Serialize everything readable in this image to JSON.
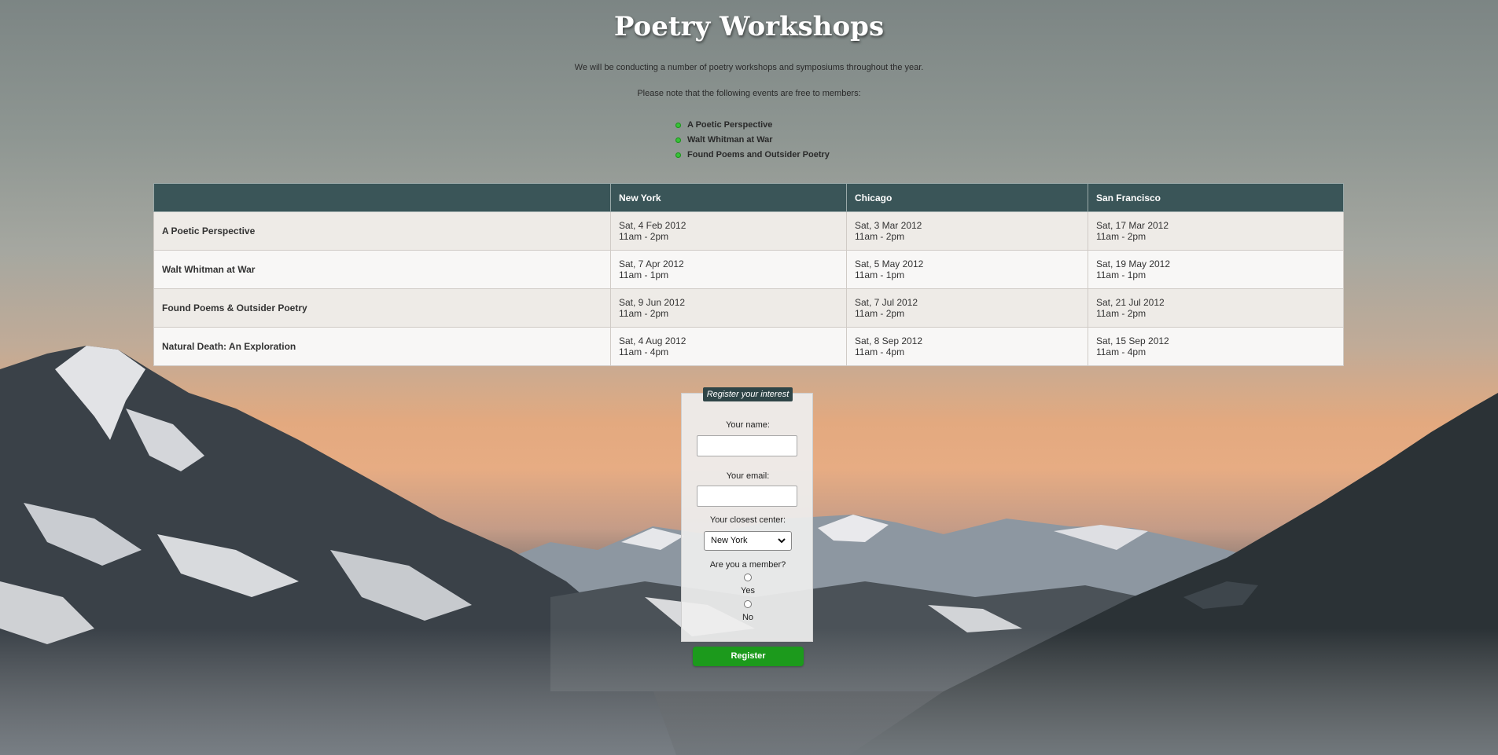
{
  "page": {
    "title": "Poetry Workshops",
    "intro_1": "We will be conducting a number of poetry workshops and symposiums throughout the year.",
    "intro_2": "Please note that the following events are free to members:"
  },
  "free_events": [
    "A Poetic Perspective",
    "Walt Whitman at War",
    "Found Poems and Outsider Poetry"
  ],
  "schedule": {
    "headers": [
      "",
      "New York",
      "Chicago",
      "San Francisco"
    ],
    "rows": [
      {
        "event": "A Poetic Perspective",
        "new_york": {
          "date": "Sat, 4 Feb 2012",
          "time": "11am - 2pm"
        },
        "chicago": {
          "date": "Sat, 3 Mar 2012",
          "time": "11am - 2pm"
        },
        "san_francisco": {
          "date": "Sat, 17 Mar 2012",
          "time": "11am - 2pm"
        }
      },
      {
        "event": "Walt Whitman at War",
        "new_york": {
          "date": "Sat, 7 Apr 2012",
          "time": "11am - 1pm"
        },
        "chicago": {
          "date": "Sat, 5 May 2012",
          "time": "11am - 1pm"
        },
        "san_francisco": {
          "date": "Sat, 19 May 2012",
          "time": "11am - 1pm"
        }
      },
      {
        "event": "Found Poems & Outsider Poetry",
        "new_york": {
          "date": "Sat, 9 Jun 2012",
          "time": "11am - 2pm"
        },
        "chicago": {
          "date": "Sat, 7 Jul 2012",
          "time": "11am - 2pm"
        },
        "san_francisco": {
          "date": "Sat, 21 Jul 2012",
          "time": "11am - 2pm"
        }
      },
      {
        "event": "Natural Death: An Exploration",
        "new_york": {
          "date": "Sat, 4 Aug 2012",
          "time": "11am - 4pm"
        },
        "chicago": {
          "date": "Sat, 8 Sep 2012",
          "time": "11am - 4pm"
        },
        "san_francisco": {
          "date": "Sat, 15 Sep 2012",
          "time": "11am - 4pm"
        }
      }
    ]
  },
  "form": {
    "legend": "Register your interest",
    "name_label": "Your name:",
    "name_value": "",
    "email_label": "Your email:",
    "email_value": "",
    "center_label": "Your closest center:",
    "center_selected": "New York",
    "member_label": "Are you a member?",
    "member_options": [
      "Yes",
      "No"
    ],
    "submit_label": "Register"
  },
  "colors": {
    "table_header": "#3a5558",
    "legend_bg": "#2f4547",
    "register_button": "#1c9a1c",
    "bullet": "#37c237"
  },
  "icons": {
    "select_chevron": "chevron-down-icon",
    "list_bullet": "bullet-icon"
  }
}
